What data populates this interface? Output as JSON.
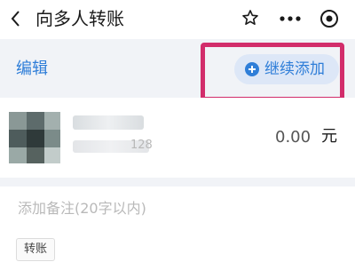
{
  "header": {
    "title": "向多人转账",
    "icons": [
      "back-icon",
      "star-icon",
      "more-icon",
      "record-icon"
    ]
  },
  "toolbar": {
    "edit_label": "编辑",
    "add_label": "继续添加"
  },
  "recipient": {
    "account_suffix": "128",
    "amount": "0.00",
    "unit": "元"
  },
  "note": {
    "placeholder": "添加备注(20字以内)",
    "value": ""
  },
  "tag": {
    "label": "转账"
  },
  "colors": {
    "accent": "#2f7ed8",
    "highlight": "#d22d6b",
    "background": "#f1f3f7"
  }
}
